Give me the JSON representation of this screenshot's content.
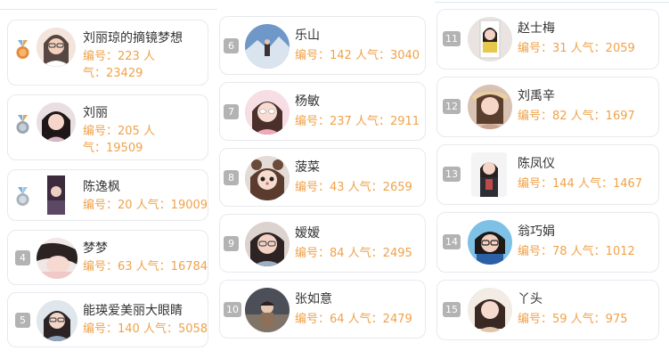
{
  "labels": {
    "id_prefix": "编号：",
    "popularity_prefix": "人气："
  },
  "accent_color": "#efa24a",
  "badge_color": "#b3b3b3",
  "entries": [
    {
      "rank": "",
      "medal": "bronze",
      "name": "刘丽琼的摘镜梦想",
      "id": "223",
      "popularity": "23429"
    },
    {
      "rank": "",
      "medal": "bronze-silver",
      "name": "刘丽",
      "id": "205",
      "popularity": "19509"
    },
    {
      "rank": "",
      "medal": "silver",
      "name": "陈逸枫",
      "id": "20",
      "popularity": "19009"
    },
    {
      "rank": "4",
      "name": "梦梦",
      "id": "63",
      "popularity": "16784"
    },
    {
      "rank": "5",
      "name": "能瑛爱美丽大眼睛",
      "id": "140",
      "popularity": "5058"
    },
    {
      "rank": "6",
      "name": "乐山",
      "id": "142",
      "popularity": "3040"
    },
    {
      "rank": "7",
      "name": "杨敏",
      "id": "237",
      "popularity": "2911"
    },
    {
      "rank": "8",
      "name": "菠菜",
      "id": "43",
      "popularity": "2659"
    },
    {
      "rank": "9",
      "name": "嫒嫒",
      "id": "84",
      "popularity": "2495"
    },
    {
      "rank": "10",
      "name": "张如意",
      "id": "64",
      "popularity": "2479"
    },
    {
      "rank": "11",
      "name": "赵士梅",
      "id": "31",
      "popularity": "2059"
    },
    {
      "rank": "12",
      "name": "刘禹辛",
      "id": "82",
      "popularity": "1697"
    },
    {
      "rank": "13",
      "name": "陈凤仪",
      "id": "144",
      "popularity": "1467"
    },
    {
      "rank": "14",
      "name": "翁巧娟",
      "id": "78",
      "popularity": "1012"
    },
    {
      "rank": "15",
      "name": "丫头",
      "id": "59",
      "popularity": "975"
    }
  ],
  "meta_lines": {
    "e0_a": "编号：223 人",
    "e0_b": "气：23429",
    "e1_a": "编号：205 人",
    "e1_b": "气：19509",
    "e2": "编号：20 人气：19009",
    "e3": "编号：63 人气：16784",
    "e4": "编号：140 人气：5058",
    "e5": "编号：142 人气：3040",
    "e6": "编号：237 人气：2911",
    "e7": "编号：43 人气：2659",
    "e8": "编号：84 人气：2495",
    "e9": "编号：64 人气：2479",
    "e10": "编号：31 人气：2059",
    "e11": "编号：82 人气：1697",
    "e12": "编号：144 人气：1467",
    "e13": "编号：78 人气：1012",
    "e14": "编号：59 人气：975"
  }
}
